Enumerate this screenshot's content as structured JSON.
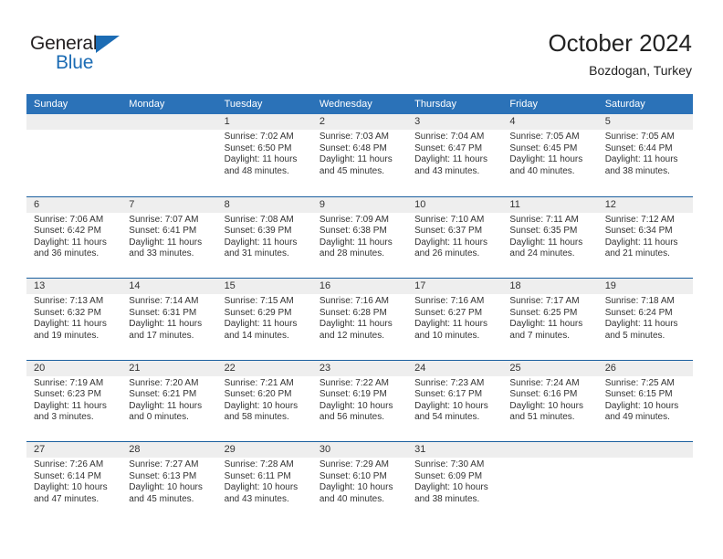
{
  "logo": {
    "word_top": "General",
    "word_bottom": "Blue",
    "triangle_color": "#1c6cb4"
  },
  "header": {
    "title": "October 2024",
    "subtitle": "Bozdogan, Turkey"
  },
  "theme": {
    "header_blue": "#2b72b8",
    "row_divider_blue": "#1b609f",
    "daynum_band": "#eeeeee",
    "text": "#333333"
  },
  "calendar": {
    "weekdays": [
      "Sunday",
      "Monday",
      "Tuesday",
      "Wednesday",
      "Thursday",
      "Friday",
      "Saturday"
    ],
    "weeks": [
      [
        {
          "day": "",
          "lines": []
        },
        {
          "day": "",
          "lines": []
        },
        {
          "day": "1",
          "lines": [
            "Sunrise: 7:02 AM",
            "Sunset: 6:50 PM",
            "Daylight: 11 hours",
            "and 48 minutes."
          ]
        },
        {
          "day": "2",
          "lines": [
            "Sunrise: 7:03 AM",
            "Sunset: 6:48 PM",
            "Daylight: 11 hours",
            "and 45 minutes."
          ]
        },
        {
          "day": "3",
          "lines": [
            "Sunrise: 7:04 AM",
            "Sunset: 6:47 PM",
            "Daylight: 11 hours",
            "and 43 minutes."
          ]
        },
        {
          "day": "4",
          "lines": [
            "Sunrise: 7:05 AM",
            "Sunset: 6:45 PM",
            "Daylight: 11 hours",
            "and 40 minutes."
          ]
        },
        {
          "day": "5",
          "lines": [
            "Sunrise: 7:05 AM",
            "Sunset: 6:44 PM",
            "Daylight: 11 hours",
            "and 38 minutes."
          ]
        }
      ],
      [
        {
          "day": "6",
          "lines": [
            "Sunrise: 7:06 AM",
            "Sunset: 6:42 PM",
            "Daylight: 11 hours",
            "and 36 minutes."
          ]
        },
        {
          "day": "7",
          "lines": [
            "Sunrise: 7:07 AM",
            "Sunset: 6:41 PM",
            "Daylight: 11 hours",
            "and 33 minutes."
          ]
        },
        {
          "day": "8",
          "lines": [
            "Sunrise: 7:08 AM",
            "Sunset: 6:39 PM",
            "Daylight: 11 hours",
            "and 31 minutes."
          ]
        },
        {
          "day": "9",
          "lines": [
            "Sunrise: 7:09 AM",
            "Sunset: 6:38 PM",
            "Daylight: 11 hours",
            "and 28 minutes."
          ]
        },
        {
          "day": "10",
          "lines": [
            "Sunrise: 7:10 AM",
            "Sunset: 6:37 PM",
            "Daylight: 11 hours",
            "and 26 minutes."
          ]
        },
        {
          "day": "11",
          "lines": [
            "Sunrise: 7:11 AM",
            "Sunset: 6:35 PM",
            "Daylight: 11 hours",
            "and 24 minutes."
          ]
        },
        {
          "day": "12",
          "lines": [
            "Sunrise: 7:12 AM",
            "Sunset: 6:34 PM",
            "Daylight: 11 hours",
            "and 21 minutes."
          ]
        }
      ],
      [
        {
          "day": "13",
          "lines": [
            "Sunrise: 7:13 AM",
            "Sunset: 6:32 PM",
            "Daylight: 11 hours",
            "and 19 minutes."
          ]
        },
        {
          "day": "14",
          "lines": [
            "Sunrise: 7:14 AM",
            "Sunset: 6:31 PM",
            "Daylight: 11 hours",
            "and 17 minutes."
          ]
        },
        {
          "day": "15",
          "lines": [
            "Sunrise: 7:15 AM",
            "Sunset: 6:29 PM",
            "Daylight: 11 hours",
            "and 14 minutes."
          ]
        },
        {
          "day": "16",
          "lines": [
            "Sunrise: 7:16 AM",
            "Sunset: 6:28 PM",
            "Daylight: 11 hours",
            "and 12 minutes."
          ]
        },
        {
          "day": "17",
          "lines": [
            "Sunrise: 7:16 AM",
            "Sunset: 6:27 PM",
            "Daylight: 11 hours",
            "and 10 minutes."
          ]
        },
        {
          "day": "18",
          "lines": [
            "Sunrise: 7:17 AM",
            "Sunset: 6:25 PM",
            "Daylight: 11 hours",
            "and 7 minutes."
          ]
        },
        {
          "day": "19",
          "lines": [
            "Sunrise: 7:18 AM",
            "Sunset: 6:24 PM",
            "Daylight: 11 hours",
            "and 5 minutes."
          ]
        }
      ],
      [
        {
          "day": "20",
          "lines": [
            "Sunrise: 7:19 AM",
            "Sunset: 6:23 PM",
            "Daylight: 11 hours",
            "and 3 minutes."
          ]
        },
        {
          "day": "21",
          "lines": [
            "Sunrise: 7:20 AM",
            "Sunset: 6:21 PM",
            "Daylight: 11 hours",
            "and 0 minutes."
          ]
        },
        {
          "day": "22",
          "lines": [
            "Sunrise: 7:21 AM",
            "Sunset: 6:20 PM",
            "Daylight: 10 hours",
            "and 58 minutes."
          ]
        },
        {
          "day": "23",
          "lines": [
            "Sunrise: 7:22 AM",
            "Sunset: 6:19 PM",
            "Daylight: 10 hours",
            "and 56 minutes."
          ]
        },
        {
          "day": "24",
          "lines": [
            "Sunrise: 7:23 AM",
            "Sunset: 6:17 PM",
            "Daylight: 10 hours",
            "and 54 minutes."
          ]
        },
        {
          "day": "25",
          "lines": [
            "Sunrise: 7:24 AM",
            "Sunset: 6:16 PM",
            "Daylight: 10 hours",
            "and 51 minutes."
          ]
        },
        {
          "day": "26",
          "lines": [
            "Sunrise: 7:25 AM",
            "Sunset: 6:15 PM",
            "Daylight: 10 hours",
            "and 49 minutes."
          ]
        }
      ],
      [
        {
          "day": "27",
          "lines": [
            "Sunrise: 7:26 AM",
            "Sunset: 6:14 PM",
            "Daylight: 10 hours",
            "and 47 minutes."
          ]
        },
        {
          "day": "28",
          "lines": [
            "Sunrise: 7:27 AM",
            "Sunset: 6:13 PM",
            "Daylight: 10 hours",
            "and 45 minutes."
          ]
        },
        {
          "day": "29",
          "lines": [
            "Sunrise: 7:28 AM",
            "Sunset: 6:11 PM",
            "Daylight: 10 hours",
            "and 43 minutes."
          ]
        },
        {
          "day": "30",
          "lines": [
            "Sunrise: 7:29 AM",
            "Sunset: 6:10 PM",
            "Daylight: 10 hours",
            "and 40 minutes."
          ]
        },
        {
          "day": "31",
          "lines": [
            "Sunrise: 7:30 AM",
            "Sunset: 6:09 PM",
            "Daylight: 10 hours",
            "and 38 minutes."
          ]
        },
        {
          "day": "",
          "lines": []
        },
        {
          "day": "",
          "lines": []
        }
      ]
    ]
  }
}
